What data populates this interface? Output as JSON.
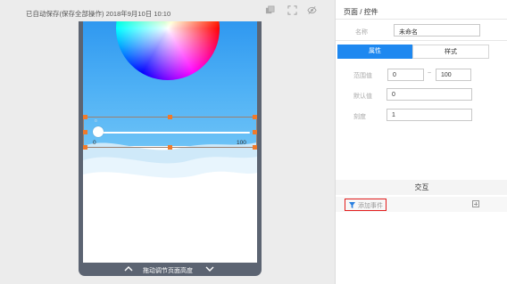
{
  "canvas": {
    "save_status": "已自动保存(保存全部操作) 2018年9月10日 10:10",
    "toolbar_icons": [
      "layers-icon",
      "fullscreen-icon",
      "eye-off-icon"
    ]
  },
  "component": {
    "slider_min_label": "0",
    "slider_max_label": "100",
    "slider_value_fraction": 0,
    "bottom_bar_label": "拖动调节页面高度"
  },
  "panel": {
    "title": "页面 / 控件",
    "name_label": "名称",
    "name_value": "未命名",
    "tabs": [
      {
        "label": "属性",
        "active": true
      },
      {
        "label": "样式",
        "active": false
      }
    ],
    "range_label": "范围值",
    "range_min": "0",
    "range_separator": "~",
    "range_max": "100",
    "default_label": "默认值",
    "default_value": "0",
    "step_label": "刻度",
    "step_value": "1",
    "interaction_title": "交互",
    "add_event_label": "添加事件"
  },
  "colors": {
    "accent": "#1e88f0",
    "handle": "#f07a2a",
    "highlight_border": "#e21d1d",
    "phone_frame": "#5c6472",
    "sky_top": "#2f98f0"
  }
}
